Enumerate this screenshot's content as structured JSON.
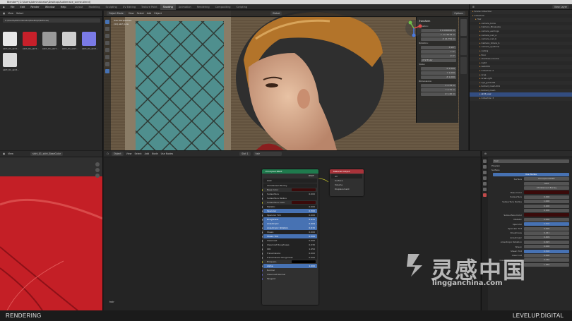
{
  "window": {
    "title": "Blender* [C:\\Users\\Administrator\\Desktop\\Audiemace_scene.blend]"
  },
  "menubar": {
    "items": [
      "File",
      "Edit",
      "Render",
      "Window",
      "Help"
    ],
    "workspaces": [
      "Layout",
      "Modeling",
      "Sculpting",
      "UV Editing",
      "Texture Paint",
      "Shading",
      "Animation",
      "Rendering",
      "Compositing",
      "Scripting"
    ],
    "active_workspace": "Shading",
    "scene": "Scene",
    "view_layer": "View Layer"
  },
  "filebrowser": {
    "menus": [
      "View",
      "Select"
    ],
    "path": "C:\\Users\\Administrator\\Desktop\\Textures\\",
    "files": [
      {
        "label": "skirt_01_skirt...",
        "color": "#e8e8e8"
      },
      {
        "label": "skirt_01_skirt...",
        "color": "#c8202a"
      },
      {
        "label": "skirt_01_skirt...",
        "color": "#9a9a9a"
      },
      {
        "label": "skirt_01_skirt...",
        "color": "#cfcfcf"
      },
      {
        "label": "skirt_01_skirt...",
        "color": "#7a7ae6"
      },
      {
        "label": "skirt_01_skirt...",
        "color": "#dcdcdc"
      }
    ]
  },
  "viewport": {
    "mode": "Object Mode",
    "menus": [
      "View",
      "Select",
      "Add",
      "Object"
    ],
    "transform": "Global",
    "overlay_text": [
      "User Perspective",
      "(11) skirt_Low"
    ],
    "options": "Options"
  },
  "npanel": {
    "tab": "Transform",
    "location_label": "Location:",
    "location": [
      "X 0.000000 m",
      "Y -0.73578 m",
      "Z 14.759 m"
    ],
    "rotation_label": "Rotation:",
    "rotation": [
      "X 90°",
      "Y 0°",
      "Z 0°"
    ],
    "mode": "XYZ Euler",
    "scale_label": "Scale:",
    "scale": [
      "X 1.000",
      "Y 1.000",
      "Z 1.000"
    ],
    "dimensions_label": "Dimensions:",
    "dimensions": [
      "X 2.34 m",
      "Y 2.75 m",
      "Z 1.46 m"
    ]
  },
  "outliner": {
    "search": "",
    "view_layer": "View Layer",
    "rows": [
      {
        "label": "Scene Collection",
        "sel": false
      },
      {
        "label": "Collection",
        "sel": false
      },
      {
        "label": "Hair",
        "sel": false
      },
      {
        "label": "camera_bone",
        "sel": false
      },
      {
        "label": "Camera_BoneLate",
        "sel": false
      },
      {
        "label": "camera_earrings",
        "sel": false
      },
      {
        "label": "camera_nail_a",
        "sel": false
      },
      {
        "label": "camera_nail_b",
        "sel": false
      },
      {
        "label": "Camera_Sclera_b",
        "sel": false
      },
      {
        "label": "camera_eyebrow",
        "sel": false
      },
      {
        "label": "ceiling",
        "sel": false
      },
      {
        "label": "floor",
        "sel": false
      },
      {
        "label": "shadows.volume",
        "sel": false
      },
      {
        "label": "Light",
        "sel": false
      },
      {
        "label": "wall.001",
        "sel": false
      },
      {
        "label": "Collection 2",
        "sel": false
      },
      {
        "label": "Area",
        "sel": false
      },
      {
        "label": "Area.Light",
        "sel": false
      },
      {
        "label": "eye_gold.001",
        "sel": false
      },
      {
        "label": "bodied_mesh.001",
        "sel": false
      },
      {
        "label": "bodied_mesh",
        "sel": false
      },
      {
        "label": "skirt_Low",
        "sel": true
      },
      {
        "label": "Collection 3",
        "sel": false
      }
    ]
  },
  "imgeditor": {
    "mode": "View",
    "image": "skirt_01_skirt_BaseColor"
  },
  "nodeeditor": {
    "object": "Object",
    "menus": [
      "View",
      "Select",
      "Add",
      "Node"
    ],
    "use_nodes": "Use Nodes",
    "slot": "Slot 1",
    "material": "hair",
    "corner_label": "hair",
    "bsdf": {
      "title": "Principled BSDF",
      "out": "BSDF",
      "dist": "GGX",
      "sss": "Christensen-Burley",
      "rows": [
        {
          "label": "Base Color",
          "kind": "color",
          "value": ""
        },
        {
          "label": "Subsurface",
          "kind": "dark",
          "value": "0.000"
        },
        {
          "label": "Subsurface Radius",
          "kind": "dark",
          "value": ""
        },
        {
          "label": "Subsurface Color",
          "kind": "color",
          "value": ""
        },
        {
          "label": "Metallic",
          "kind": "dark",
          "value": "0.000"
        },
        {
          "label": "Specular",
          "kind": "slider",
          "value": "0.500"
        },
        {
          "label": "Specular Tint",
          "kind": "dark",
          "value": "0.000"
        },
        {
          "label": "Roughness",
          "kind": "slider",
          "value": "0.441"
        },
        {
          "label": "Anisotropic",
          "kind": "slider",
          "value": "0.409"
        },
        {
          "label": "Anisotropic Rotation",
          "kind": "slider",
          "value": "0.615"
        },
        {
          "label": "Sheen",
          "kind": "dark",
          "value": "0.000"
        },
        {
          "label": "Sheen Tint",
          "kind": "slider",
          "value": "0.500"
        },
        {
          "label": "Clearcoat",
          "kind": "dark",
          "value": "0.000"
        },
        {
          "label": "Clearcoat Roughness",
          "kind": "dark",
          "value": "0.030"
        },
        {
          "label": "IOR",
          "kind": "dark",
          "value": "1.450"
        },
        {
          "label": "Transmission",
          "kind": "dark",
          "value": "0.000"
        },
        {
          "label": "Transmission Roughness",
          "kind": "dark",
          "value": "0.000"
        },
        {
          "label": "Emission",
          "kind": "black",
          "value": ""
        },
        {
          "label": "Alpha",
          "kind": "slider",
          "value": "1.000"
        },
        {
          "label": "Normal",
          "kind": "plain",
          "value": ""
        },
        {
          "label": "Clearcoat Normal",
          "kind": "plain",
          "value": ""
        },
        {
          "label": "Tangent",
          "kind": "plain",
          "value": ""
        }
      ]
    },
    "output": {
      "title": "Material Output",
      "target": "All",
      "rows": [
        "Surface",
        "Volume",
        "Displacement"
      ]
    }
  },
  "props": {
    "material_name": "hair",
    "sections": [
      "Preview",
      "Surface"
    ],
    "use_nodes": "Use Nodes",
    "surface_label": "Surface",
    "surface_value": "Principled BSDF",
    "dist": "GGX",
    "sss": "Christensen-Burley",
    "rows": [
      {
        "label": "Base Color",
        "value": ""
      },
      {
        "label": "Subsurface",
        "value": "0.000"
      },
      {
        "label": "Subsurface Radius",
        "value": "1.000"
      },
      {
        "label": "",
        "value": "0.200"
      },
      {
        "label": "",
        "value": "0.100"
      },
      {
        "label": "Subsurface Color",
        "value": ""
      },
      {
        "label": "Metallic",
        "value": "0.000"
      },
      {
        "label": "Specular",
        "value": "0.500"
      },
      {
        "label": "Specular Tint",
        "value": "0.000"
      },
      {
        "label": "Roughness",
        "value": "0.441"
      },
      {
        "label": "Anisotropic",
        "value": "0.409"
      },
      {
        "label": "Anisotropic Rotation",
        "value": "0.615"
      },
      {
        "label": "Sheen",
        "value": "0.000"
      },
      {
        "label": "Sheen Tint",
        "value": "0.500"
      },
      {
        "label": "Clearcoat",
        "value": "0.000"
      },
      {
        "label": "Clearcoat Roughness",
        "value": "0.030"
      },
      {
        "label": "IOR",
        "value": "1.450"
      }
    ]
  },
  "status": {
    "left": "RENDERING",
    "right": "LEVELUP.DIGITAL"
  },
  "watermark": {
    "cn": "灵感中国",
    "url": "lingganchina.com"
  },
  "colors": {
    "accent": "#4772b3",
    "bsdf_header": "#1f7a4d",
    "output_header": "#a8333a",
    "red_fabric": "#c41f26"
  }
}
